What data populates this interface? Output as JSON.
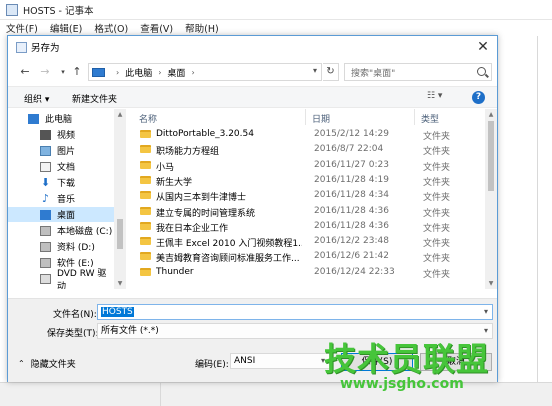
{
  "notepad": {
    "title": "HOSTS - 记事本",
    "menu": [
      "文件(F)",
      "编辑(E)",
      "格式(O)",
      "查看(V)",
      "帮助(H)"
    ]
  },
  "dialog": {
    "title": "另存为",
    "address": {
      "crumbs": [
        "此电脑",
        "桌面"
      ]
    },
    "search_placeholder": "搜索\"桌面\"",
    "toolbar": {
      "organize": "组织 ▾",
      "new_folder": "新建文件夹"
    },
    "nav": [
      {
        "label": "此电脑",
        "icon": "computer-icon"
      },
      {
        "label": "视频",
        "icon": "video-icon"
      },
      {
        "label": "图片",
        "icon": "pictures-icon"
      },
      {
        "label": "文档",
        "icon": "documents-icon"
      },
      {
        "label": "下载",
        "icon": "download-icon"
      },
      {
        "label": "音乐",
        "icon": "music-icon"
      },
      {
        "label": "桌面",
        "icon": "desktop-icon",
        "selected": true
      },
      {
        "label": "本地磁盘 (C:)",
        "icon": "drive-icon"
      },
      {
        "label": "资料 (D:)",
        "icon": "drive-icon"
      },
      {
        "label": "软件 (E:)",
        "icon": "drive-icon"
      },
      {
        "label": "DVD RW 驱动",
        "icon": "dvd-icon"
      }
    ],
    "columns": {
      "name": "名称",
      "date": "日期",
      "type": "类型"
    },
    "files": [
      {
        "name": "DittoPortable_3.20.54",
        "date": "2015/2/12 14:29",
        "type": "文件夹"
      },
      {
        "name": "职场能力方程组",
        "date": "2016/8/7 22:04",
        "type": "文件夹"
      },
      {
        "name": "小马",
        "date": "2016/11/27 0:23",
        "type": "文件夹"
      },
      {
        "name": "新生大学",
        "date": "2016/11/28 4:19",
        "type": "文件夹"
      },
      {
        "name": "从国内三本到牛津博士",
        "date": "2016/11/28 4:34",
        "type": "文件夹"
      },
      {
        "name": "建立专属的时间管理系统",
        "date": "2016/11/28 4:36",
        "type": "文件夹"
      },
      {
        "name": "我在日本企业工作",
        "date": "2016/11/28 4:36",
        "type": "文件夹"
      },
      {
        "name": "王佩丰 Excel 2010 入门视频教程1...",
        "date": "2016/12/2 23:48",
        "type": "文件夹"
      },
      {
        "name": "美吉姆教育咨询顾问标准服务工作...",
        "date": "2016/12/6 21:42",
        "type": "文件夹"
      },
      {
        "name": "Thunder",
        "date": "2016/12/24 22:33",
        "type": "文件夹"
      }
    ],
    "form": {
      "filename_label": "文件名(N):",
      "filename_value": "HOSTS",
      "filetype_label": "保存类型(T):",
      "filetype_value": "所有文件  (*.*)",
      "hide_folders": "隐藏文件夹",
      "encoding_label": "编码(E):",
      "encoding_value": "ANSI",
      "save": "保存(S)",
      "cancel": "取消"
    }
  },
  "watermark": {
    "big": "技术员联盟",
    "small": "www.jsgho.com"
  },
  "colors": {
    "selection": "#cce8ff",
    "accent": "#0078d7",
    "folder": "#f4c542",
    "watermark": "#46c53a"
  }
}
